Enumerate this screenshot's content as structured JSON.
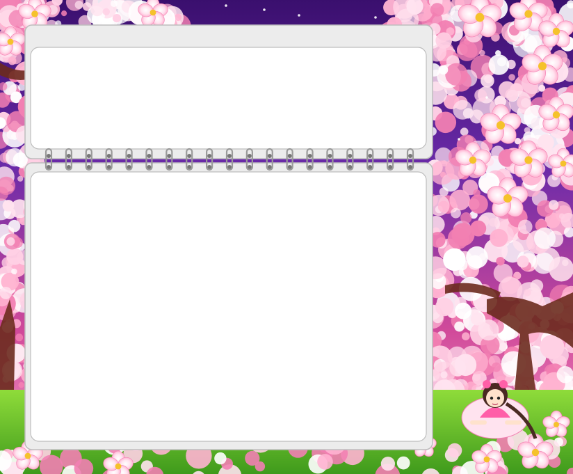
{
  "theme": {
    "sky_top": "#3a0f6e",
    "sky_mid": "#6a2aa8",
    "sky_glow": "#d14a9a",
    "blossom_light": "#ffe3ef",
    "blossom_mid": "#ffb3d1",
    "blossom_dark": "#f27fb2",
    "blossom_center": "#f5c22b",
    "trunk": "#6b2b1e",
    "grass_light": "#8fdc3a",
    "grass_dark": "#3f9a1c",
    "panel_frame": "#ececec",
    "panel_border": "#bdbdbd",
    "panel_fill": "#ffffff",
    "ring_color": "#9a9a9a"
  },
  "binder": {
    "ring_count": 19
  },
  "character": {
    "hair": "#4a2a22",
    "dress": "#ff5fa8",
    "skin": "#ffe2cc"
  }
}
